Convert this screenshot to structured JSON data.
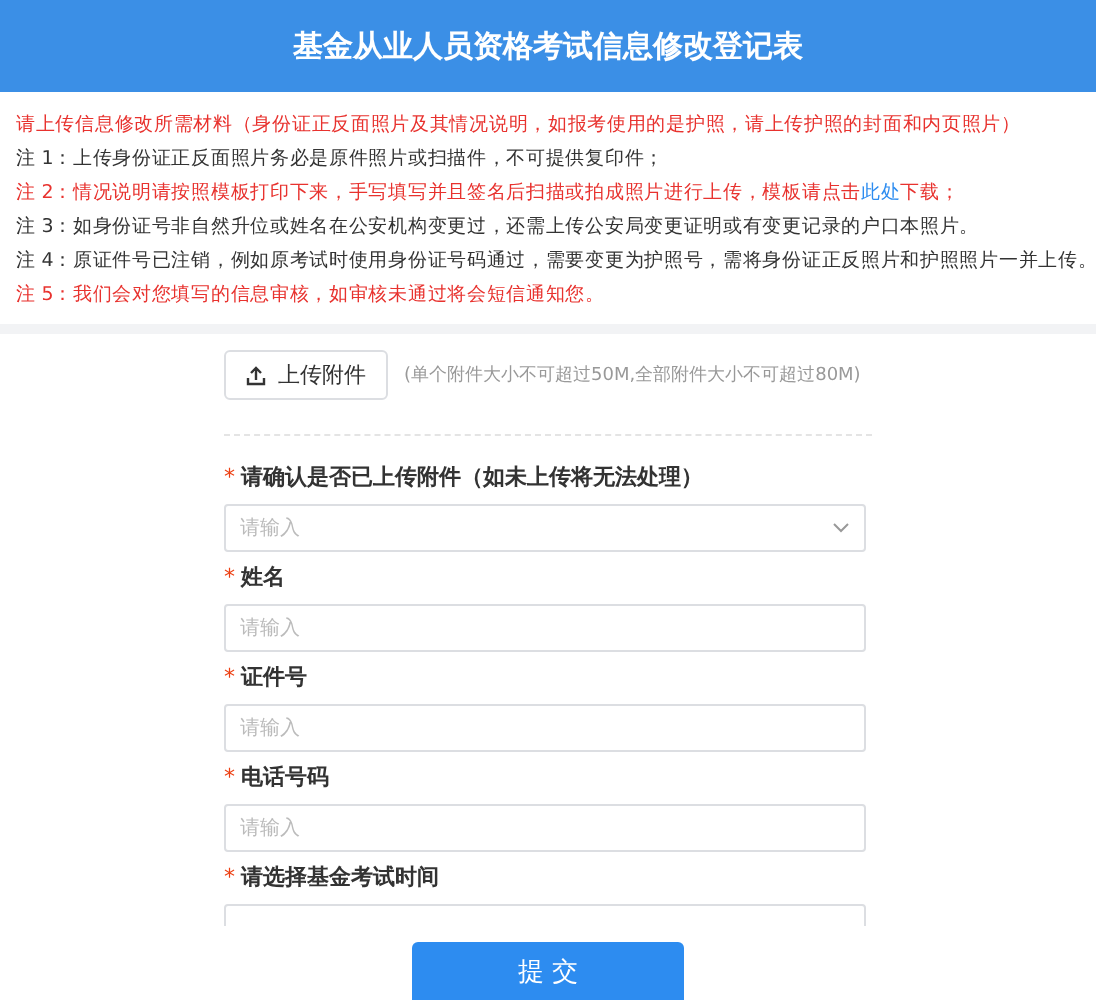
{
  "header": {
    "title": "基金从业人员资格考试信息修改登记表"
  },
  "notes": [
    {
      "color": "#e8322e",
      "parts": [
        {
          "kind": "text",
          "text": "请上传信息修改所需材料（身份证正反面照片及其情况说明，如报考使用的是护照，请上传护照的封面和内页照片）"
        }
      ]
    },
    {
      "color": "#333333",
      "parts": [
        {
          "kind": "text",
          "text": "注 1：上传身份证正反面照片务必是原件照片或扫描件，不可提供复印件；"
        }
      ]
    },
    {
      "color": "#e8322e",
      "parts": [
        {
          "kind": "text",
          "text": "注 2：情况说明请按照模板打印下来，手写填写并且签名后扫描或拍成照片进行上传，模板请点击"
        },
        {
          "kind": "link",
          "text": "此处"
        },
        {
          "kind": "text",
          "text": "下载；"
        }
      ]
    },
    {
      "color": "#333333",
      "parts": [
        {
          "kind": "text",
          "text": "注 3：如身份证号非自然升位或姓名在公安机构变更过，还需上传公安局变更证明或有变更记录的户口本照片。"
        }
      ]
    },
    {
      "color": "#333333",
      "parts": [
        {
          "kind": "text",
          "text": "注 4：原证件号已注销，例如原考试时使用身份证号码通过，需要变更为护照号，需将身份证正反照片和护照照片一并上传。"
        }
      ]
    },
    {
      "color": "#e8322e",
      "parts": [
        {
          "kind": "text",
          "text": "注 5：我们会对您填写的信息审核，如审核未通过将会短信通知您。"
        }
      ]
    }
  ],
  "upload": {
    "button": "上传附件",
    "hint": "(单个附件大小不可超过50M,全部附件大小不可超过80M)"
  },
  "fields": [
    {
      "kind": "select",
      "mark": "*",
      "label": "请确认是否已上传附件（如未上传将无法处理）",
      "placeholder": "请输入"
    },
    {
      "kind": "text",
      "mark": "*",
      "label": "姓名",
      "placeholder": "请输入"
    },
    {
      "kind": "text",
      "mark": "*",
      "label": "证件号",
      "placeholder": "请输入"
    },
    {
      "kind": "text",
      "mark": "*",
      "label": "电话号码",
      "placeholder": "请输入"
    },
    {
      "kind": "text",
      "mark": "*",
      "label": "请选择基金考试时间"
    }
  ],
  "submit": "提 交"
}
